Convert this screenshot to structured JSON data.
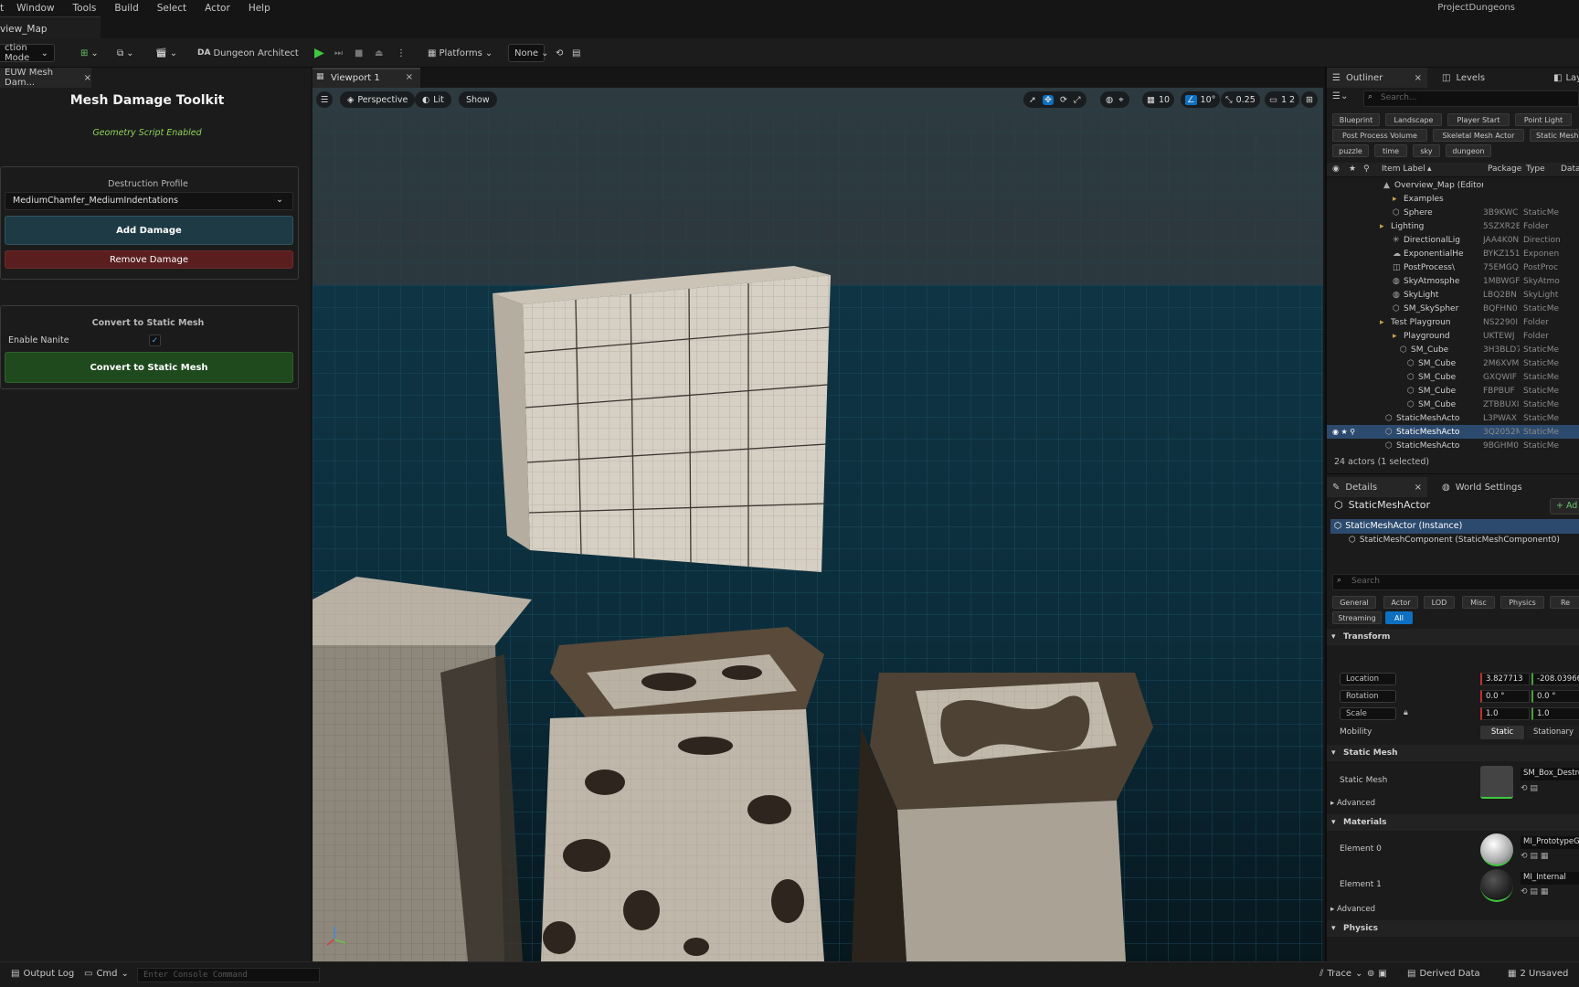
{
  "menu": [
    "t",
    "Window",
    "Tools",
    "Build",
    "Select",
    "Actor",
    "Help"
  ],
  "title_tab": "view_Map",
  "project": "ProjectDungeons",
  "toolbar": {
    "mode": "ction Mode",
    "dungeon_architect": "Dungeon Architect",
    "platforms": "Platforms",
    "none": "None"
  },
  "left_panel": {
    "tab": "EUW Mesh Dam...",
    "title": "Mesh Damage Toolkit",
    "status": "Geometry Script Enabled",
    "destruction_label": "Destruction Profile",
    "profile_value": "MediumChamfer_MediumIndentations",
    "add_damage": "Add Damage",
    "remove_damage": "Remove Damage",
    "convert_header": "Convert to Static Mesh",
    "enable_nanite": "Enable Nanite",
    "convert_button": "Convert to Static Mesh"
  },
  "viewport": {
    "tab": "Viewport 1",
    "perspective": "Perspective",
    "lit": "Lit",
    "show": "Show",
    "grid": "10",
    "angle": "10°",
    "scale": "0.25",
    "cam": "1 2"
  },
  "outliner": {
    "tab": "Outliner",
    "levels_tab": "Levels",
    "layers_tab": "Lay",
    "search_placeholder": "Search...",
    "chips": [
      "Blueprint",
      "Landscape",
      "Player Start",
      "Point Light",
      "Post Process Volume",
      "Skeletal Mesh Actor",
      "Static Mesh A",
      "puzzle",
      "time",
      "sky",
      "dungeon"
    ],
    "col_label": "Item Label",
    "col_package": "Package",
    "col_type": "Type",
    "col_data": "Data",
    "rows": [
      {
        "label": "Overview_Map (Editor)",
        "pkg": "",
        "type": ""
      },
      {
        "label": "Examples",
        "pkg": "",
        "type": ""
      },
      {
        "label": "Sphere",
        "pkg": "3B9KWC",
        "type": "StaticMe"
      },
      {
        "label": "Lighting",
        "pkg": "5SZXR2E",
        "type": "Folder"
      },
      {
        "label": "DirectionalLig",
        "pkg": "JAA4K0N",
        "type": "Direction"
      },
      {
        "label": "ExponentialHe",
        "pkg": "BYKZ151",
        "type": "Exponen"
      },
      {
        "label": "PostProcess\\",
        "pkg": "75EMGQ",
        "type": "PostProc"
      },
      {
        "label": "SkyAtmosphe",
        "pkg": "1MBWGF",
        "type": "SkyAtmo"
      },
      {
        "label": "SkyLight",
        "pkg": "LBQ2BN",
        "type": "SkyLight"
      },
      {
        "label": "SM_SkySpher",
        "pkg": "BQFHN0",
        "type": "StaticMe"
      },
      {
        "label": "Test Playgroun",
        "pkg": "NS2290I",
        "type": "Folder"
      },
      {
        "label": "Playground",
        "pkg": "UKTEWJ",
        "type": "Folder"
      },
      {
        "label": "SM_Cube",
        "pkg": "3H3BLD7",
        "type": "StaticMe"
      },
      {
        "label": "SM_Cube",
        "pkg": "2M6XVM",
        "type": "StaticMe"
      },
      {
        "label": "SM_Cube",
        "pkg": "GXQWIF",
        "type": "StaticMe"
      },
      {
        "label": "SM_Cube",
        "pkg": "FBPBUF",
        "type": "StaticMe"
      },
      {
        "label": "SM_Cube",
        "pkg": "ZTBBUXI",
        "type": "StaticMe"
      },
      {
        "label": "StaticMeshActo",
        "pkg": "L3PWAX",
        "type": "StaticMe"
      },
      {
        "label": "StaticMeshActo",
        "pkg": "3Q2052M",
        "type": "StaticMe"
      },
      {
        "label": "StaticMeshActo",
        "pkg": "9BGHM0",
        "type": "StaticMe"
      }
    ],
    "count": "24 actors (1 selected)"
  },
  "details": {
    "tab": "Details",
    "world_settings": "World Settings",
    "actor_name": "StaticMeshActor",
    "add": "+ Ad",
    "instance": "StaticMeshActor (Instance)",
    "component": "StaticMeshComponent (StaticMeshComponent0)",
    "search_placeholder": "Search",
    "filters": [
      "General",
      "Actor",
      "LOD",
      "Misc",
      "Physics",
      "Re",
      "Streaming",
      "All"
    ],
    "transform": "Transform",
    "location": "Location",
    "rotation": "Rotation",
    "scale": "Scale",
    "loc_x": "3.827713",
    "loc_y": "-208.03966",
    "rot_x": "0.0 °",
    "rot_y": "0.0 °",
    "scale_x": "1.0",
    "scale_y": "1.0",
    "mobility": "Mobility",
    "static": "Static",
    "stationary": "Stationary",
    "static_mesh_section": "Static Mesh",
    "static_mesh_label": "Static Mesh",
    "static_mesh_value": "SM_Box_Destro",
    "advanced": "Advanced",
    "materials": "Materials",
    "element0": "Element 0",
    "element0_value": "MI_PrototypeGr",
    "element1": "Element 1",
    "element1_value": "MI_Internal",
    "advanced2": "Advanced",
    "physics": "Physics"
  },
  "status": {
    "output_log": "Output Log",
    "cmd": "Cmd",
    "console_placeholder": "Enter Console Command",
    "trace": "Trace",
    "derived": "Derived Data",
    "unsaved": "2 Unsaved"
  },
  "colors": {
    "accent": "#0e70c0",
    "selected_row": "#2c4a6e",
    "add_damage_bg": "#1e3a44",
    "remove_damage_bg": "#5a1e1e",
    "convert_bg": "#1f4a1e",
    "green_text": "#8fd45a"
  }
}
